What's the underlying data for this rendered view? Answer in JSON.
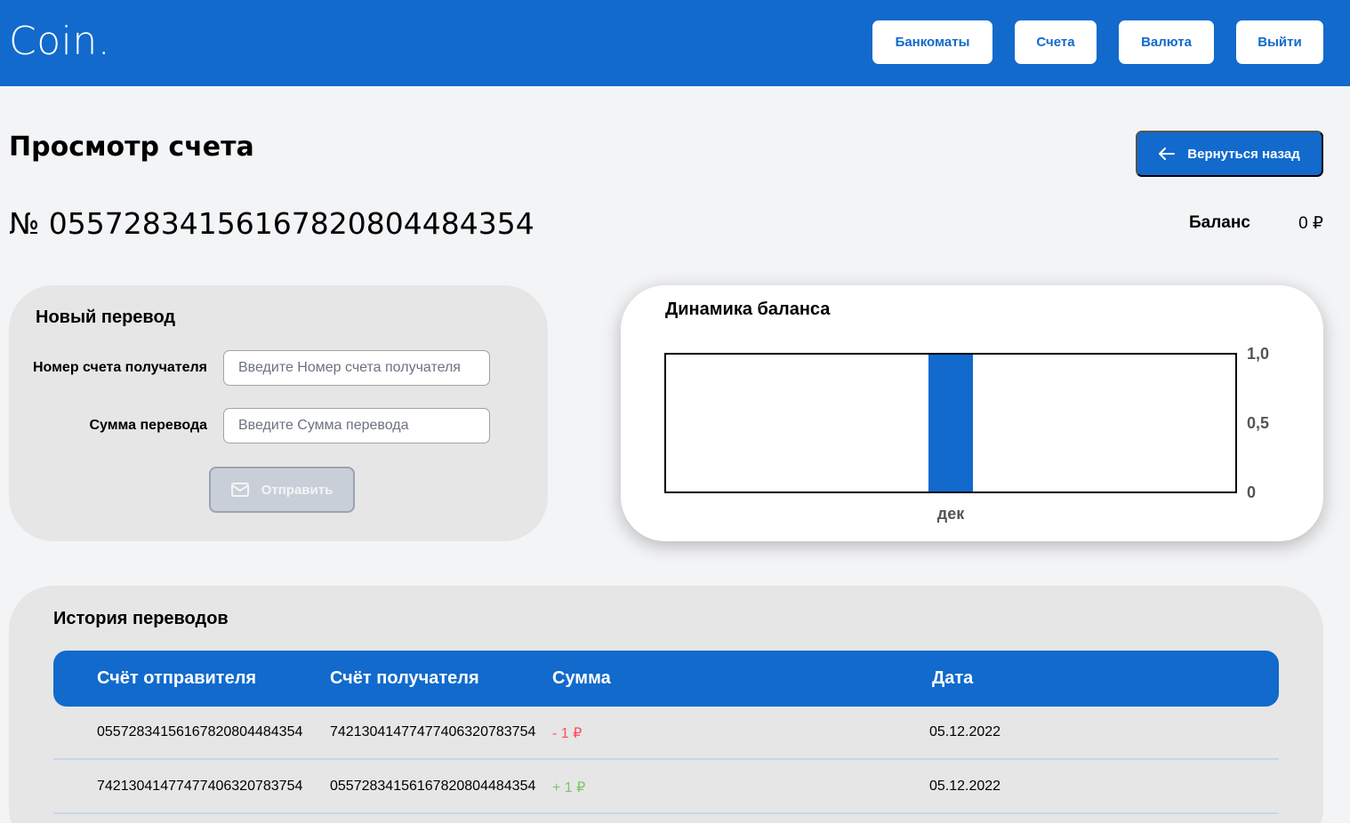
{
  "header": {
    "logo": "Coin.",
    "nav": [
      "Банкоматы",
      "Счета",
      "Валюта",
      "Выйти"
    ]
  },
  "page": {
    "title": "Просмотр счета",
    "back_label": "Вернуться назад",
    "account_number": "№ 05572834156167820804484354",
    "balance_label": "Баланс",
    "balance_value": "0 ₽"
  },
  "transfer": {
    "title": "Новый перевод",
    "account_label": "Номер счета получателя",
    "account_placeholder": "Введите Номер счета получателя",
    "amount_label": "Сумма перевода",
    "amount_placeholder": "Введите Сумма перевода",
    "send_label": "Отправить"
  },
  "chart_title": "Динамика баланса",
  "chart_data": {
    "type": "bar",
    "title": "Динамика баланса",
    "categories": [
      "дек"
    ],
    "values": [
      1
    ],
    "ylim": [
      0,
      1
    ],
    "yticks": [
      "0",
      "0,5",
      "1,0"
    ],
    "color": "#116acc"
  },
  "history": {
    "title": "История переводов",
    "columns": [
      "Счёт отправителя",
      "Счёт получателя",
      "Сумма",
      "Дата"
    ],
    "rows": [
      {
        "from": "05572834156167820804484354",
        "to": "74213041477477406320783754",
        "amount": "- 1 ₽",
        "sign": "neg",
        "date": "05.12.2022"
      },
      {
        "from": "74213041477477406320783754",
        "to": "05572834156167820804484354",
        "amount": "+ 1 ₽",
        "sign": "pos",
        "date": "05.12.2022"
      }
    ]
  },
  "colors": {
    "accent": "#116acc",
    "negative": "#ff4d5e",
    "positive": "#76ca66"
  }
}
